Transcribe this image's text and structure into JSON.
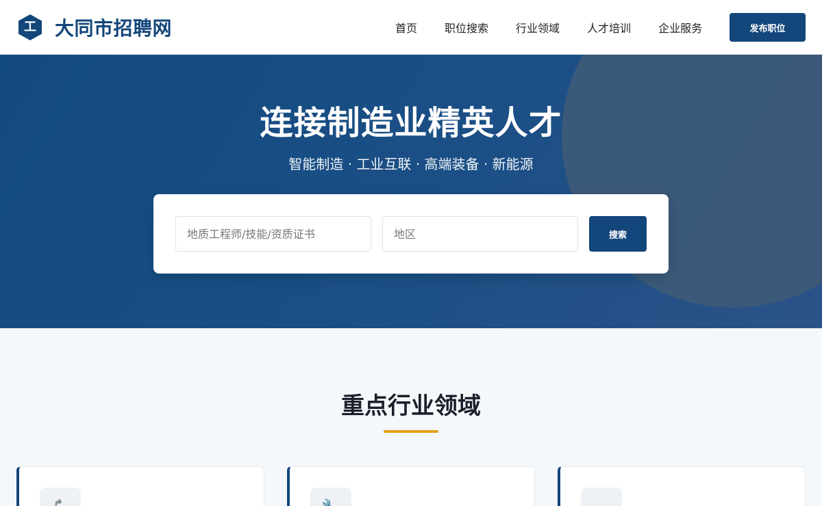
{
  "header": {
    "logo_glyph": "工",
    "site_name": "大同市招聘网",
    "nav": [
      "首页",
      "职位搜索",
      "行业领域",
      "人才培训",
      "企业服务"
    ],
    "publish_label": "发布职位"
  },
  "hero": {
    "title": "连接制造业精英人才",
    "subtitle": "智能制造 · 工业互联 · 高端装备 · 新能源"
  },
  "search": {
    "keyword_placeholder": "地质工程师/技能/资质证书",
    "region_placeholder": "地区",
    "button_label": "搜索"
  },
  "section": {
    "title": "重点行业领域"
  },
  "cards": [
    {
      "icon": "robot-arm-icon",
      "glyph": "🦾"
    },
    {
      "icon": "wrench-icon",
      "glyph": "🔧"
    },
    {
      "icon": "generic-icon",
      "glyph": ""
    }
  ],
  "colors": {
    "primary": "#13467a",
    "accent": "#e2a317",
    "hero_circle": "#3d5a78",
    "page_bg": "#f4f8fb"
  }
}
